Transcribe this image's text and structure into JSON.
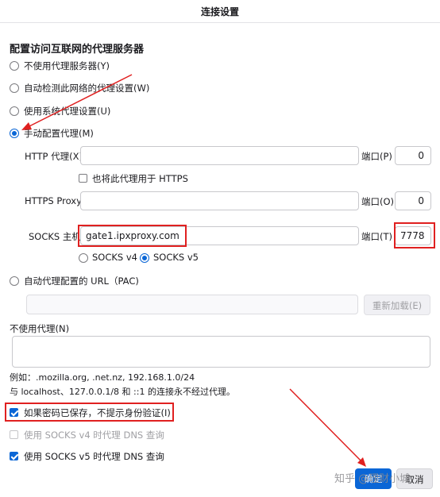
{
  "window": {
    "title": "连接设置"
  },
  "heading": "配置访问互联网的代理服务器",
  "modes": [
    {
      "label": "不使用代理服务器(Y)",
      "selected": false
    },
    {
      "label": "自动检测此网络的代理设置(W)",
      "selected": false
    },
    {
      "label": "使用系统代理设置(U)",
      "selected": false
    },
    {
      "label": "手动配置代理(M)",
      "selected": true
    }
  ],
  "http": {
    "label": "HTTP 代理(X)",
    "host": "",
    "port_label": "端口(P)",
    "port": "0"
  },
  "https_reuse": {
    "label": "也将此代理用于 HTTPS",
    "checked": false
  },
  "https": {
    "label": "HTTPS Proxy",
    "host": "",
    "port_label": "端口(O)",
    "port": "0"
  },
  "socks": {
    "label": "SOCKS 主机",
    "host": "gate1.ipxproxy.com",
    "port_label": "端口(T)",
    "port": "7778",
    "v4_label": "SOCKS v4",
    "v5_label": "SOCKS v5",
    "version": "v5"
  },
  "pac": {
    "label": "自动代理配置的 URL（PAC)",
    "selected": false,
    "url": "",
    "reload_label": "重新加载(E)"
  },
  "no_proxy": {
    "label": "不使用代理(N)",
    "value": "",
    "example": "例如：.mozilla.org, .net.nz, 192.168.1.0/24",
    "note": "与 localhost、127.0.0.1/8 和 ::1 的连接永不经过代理。"
  },
  "options": [
    {
      "label": "如果密码已保存，不提示身份验证(I)",
      "checked": true,
      "disabled": false
    },
    {
      "label": "使用 SOCKS v4 时代理 DNS 查询",
      "checked": false,
      "disabled": true
    },
    {
      "label": "使用 SOCKS v5 时代理 DNS 查询",
      "checked": true,
      "disabled": false
    }
  ],
  "buttons": {
    "ok": "确定",
    "cancel": "取消"
  },
  "watermark": "知乎 @理财小城",
  "colors": {
    "accent": "#0a66d6",
    "annotation": "#e02020"
  }
}
